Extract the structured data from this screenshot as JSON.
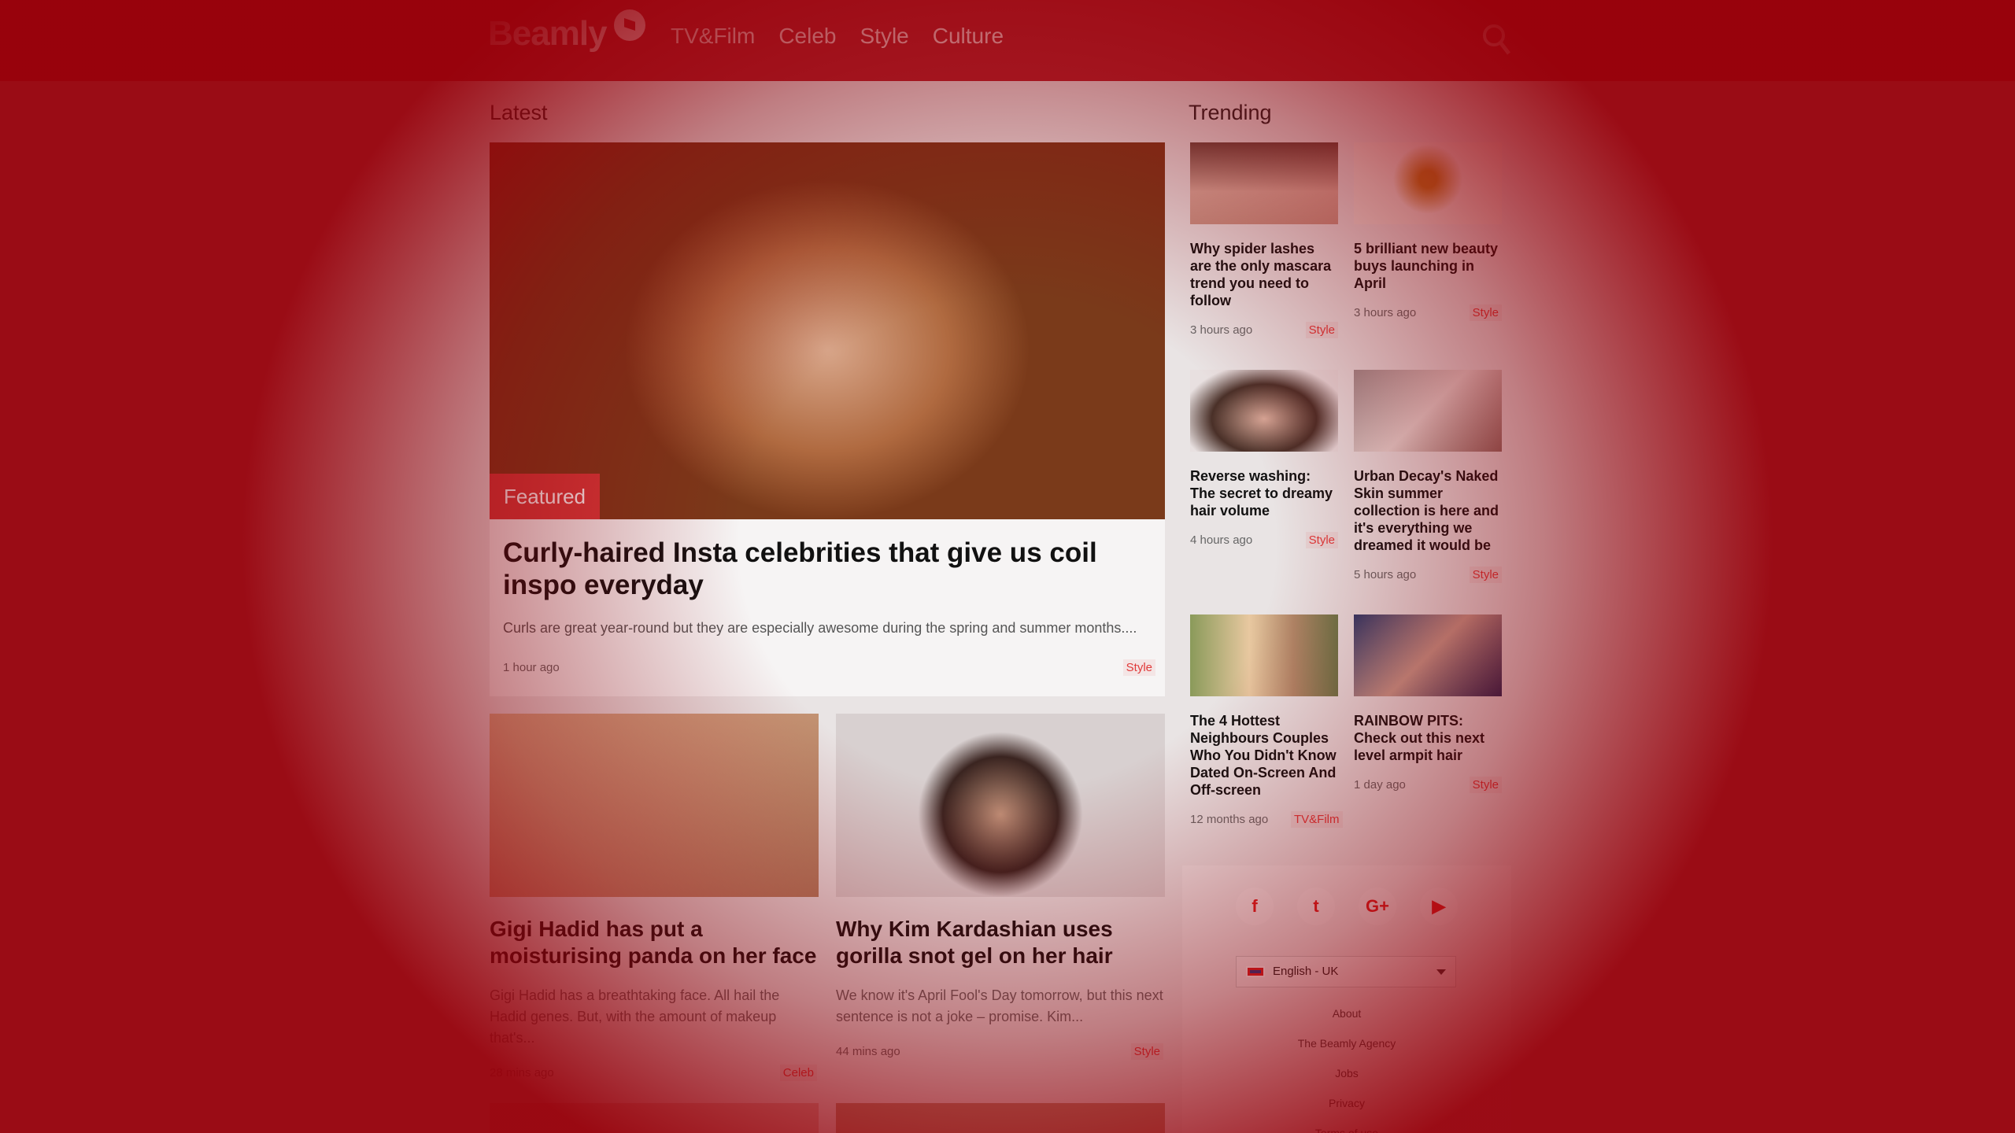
{
  "header": {
    "logo": "Beamly",
    "nav": [
      "TV&Film",
      "Celeb",
      "Style",
      "Culture"
    ]
  },
  "latest": {
    "label": "Latest",
    "featured": {
      "badge": "Featured",
      "title": "Curly-haired Insta celebrities that give us coil inspo everyday",
      "desc": "Curls are great year-round but they are especially awesome during the spring and summer months....",
      "time": "1 hour ago",
      "tag": "Style"
    },
    "cards": [
      {
        "title": "Gigi Hadid has put a moisturising panda on her face",
        "desc": "Gigi Hadid has a breathtaking face. All hail the Hadid genes. But, with the amount of makeup that's...",
        "time": "28 mins ago",
        "tag": "Celeb"
      },
      {
        "title": "Why Kim Kardashian uses gorilla snot gel on her hair",
        "desc": "We know it's April Fool's Day tomorrow, but this next sentence is not a joke – promise. Kim...",
        "time": "44 mins ago",
        "tag": "Style"
      }
    ]
  },
  "trending": {
    "label": "Trending",
    "items": [
      {
        "title": "Why spider lashes are the only mascara trend you need to follow",
        "time": "3 hours ago",
        "tag": "Style"
      },
      {
        "title": "5 brilliant new beauty buys launching in April",
        "time": "3 hours ago",
        "tag": "Style"
      },
      {
        "title": "Reverse washing: The secret to dreamy hair volume",
        "time": "4 hours ago",
        "tag": "Style"
      },
      {
        "title": "Urban Decay's Naked Skin summer collection is here and it's everything we dreamed it would be",
        "time": "5 hours ago",
        "tag": "Style"
      },
      {
        "title": "The 4 Hottest Neighbours Couples Who You Didn't Know Dated On-Screen And Off-screen",
        "time": "12 months ago",
        "tag": "TV&Film"
      },
      {
        "title": "RAINBOW PITS: Check out this next level armpit hair",
        "time": "1 day ago",
        "tag": "Style"
      }
    ]
  },
  "footer": {
    "socials": [
      "f",
      "t",
      "G+",
      "▶"
    ],
    "language": "English - UK",
    "links": [
      "About",
      "The Beamly Agency",
      "Jobs",
      "Privacy",
      "Terms of use"
    ]
  }
}
